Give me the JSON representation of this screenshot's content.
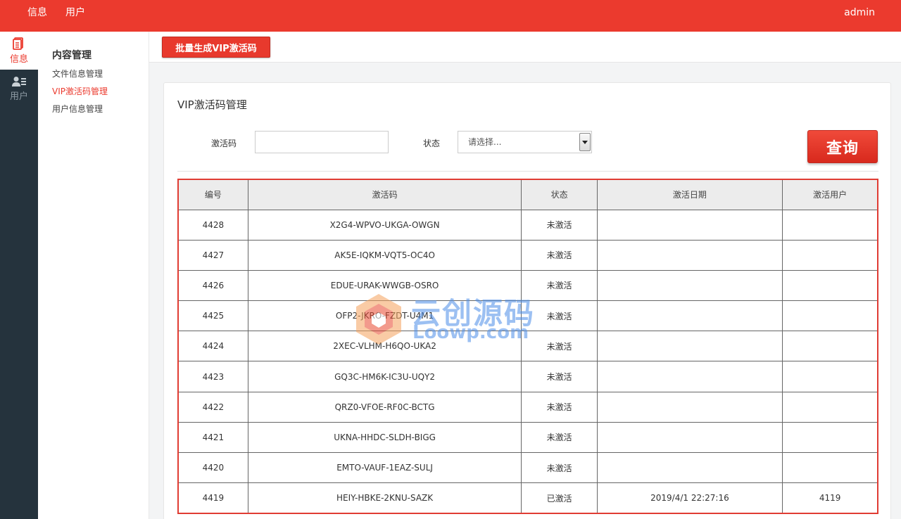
{
  "topbar": {
    "nav": [
      "信息",
      "用户"
    ],
    "user": "admin"
  },
  "rail": {
    "items": [
      {
        "label": "信息",
        "icon": "document-icon",
        "active": true
      },
      {
        "label": "用户",
        "icon": "user-list-icon",
        "active": false
      }
    ]
  },
  "submenu": {
    "group": "内容管理",
    "items": [
      "文件信息管理",
      "VIP激活码管理",
      "用户信息管理"
    ]
  },
  "actions": {
    "batch_label": "批量生成VIP激活码"
  },
  "panel": {
    "title": "VIP激活码管理",
    "filters": {
      "code_label": "激活码",
      "code_value": "",
      "status_label": "状态",
      "status_placeholder": "请选择..."
    },
    "query_label": "查询"
  },
  "table": {
    "headers": [
      "编号",
      "激活码",
      "状态",
      "激活日期",
      "激活用户"
    ],
    "rows": [
      [
        "4428",
        "X2G4-WPVO-UKGA-OWGN",
        "未激活",
        "",
        ""
      ],
      [
        "4427",
        "AK5E-IQKM-VQT5-OC4O",
        "未激活",
        "",
        ""
      ],
      [
        "4426",
        "EDUE-URAK-WWGB-OSRO",
        "未激活",
        "",
        ""
      ],
      [
        "4425",
        "OFP2-JKRO-FZDT-U4M1",
        "未激活",
        "",
        ""
      ],
      [
        "4424",
        "2XEC-VLHM-H6QO-UKA2",
        "未激活",
        "",
        ""
      ],
      [
        "4423",
        "GQ3C-HM6K-IC3U-UQY2",
        "未激活",
        "",
        ""
      ],
      [
        "4422",
        "QRZ0-VFOE-RF0C-BCTG",
        "未激活",
        "",
        ""
      ],
      [
        "4421",
        "UKNA-HHDC-SLDH-BIGG",
        "未激活",
        "",
        ""
      ],
      [
        "4420",
        "EMTO-VAUF-1EAZ-SULJ",
        "未激活",
        "",
        ""
      ],
      [
        "4419",
        "HEIY-HBKE-2KNU-SAZK",
        "已激活",
        "2019/4/1 22:27:16",
        "4119"
      ]
    ]
  },
  "watermark": {
    "line1": "云创源码",
    "line2": "Loowp.com"
  },
  "colors": {
    "brand_red": "#eb3a2e",
    "rail_dark": "#25333d"
  }
}
